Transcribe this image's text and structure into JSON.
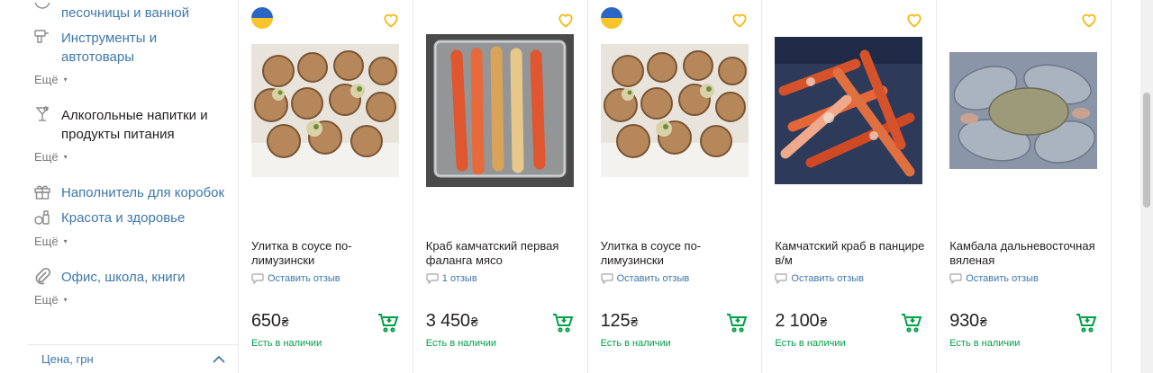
{
  "sidebar": {
    "categories": [
      {
        "label": "песочницы и ванной",
        "icon": "bath-icon"
      },
      {
        "label": "Инструменты и автотовары",
        "icon": "drill-icon"
      },
      {
        "label": "Алкогольные напитки и продукты питания",
        "icon": "glass-icon"
      },
      {
        "label": "Наполнитель для коробок",
        "icon": "gift-icon"
      },
      {
        "label": "Красота и здоровье",
        "icon": "cosmetics-icon"
      },
      {
        "label": "Офис, школа, книги",
        "icon": "paperclip-icon"
      }
    ],
    "more_label": "Ещё",
    "price_filter_label": "Цена, грн"
  },
  "colors": {
    "link": "#3e77aa",
    "available": "#00a046",
    "heart": "#f7b500",
    "ua_blue": "#2b66c5",
    "ua_yellow": "#f7c52a"
  },
  "products": [
    {
      "title": "Улитка в соусе по-лимузински",
      "review": "Оставить отзыв",
      "price": "650",
      "currency": "₴",
      "availability": "Есть в наличии",
      "has_flag": true,
      "photo": "snails-photo"
    },
    {
      "title": "Краб камчатский первая фаланга мясо",
      "review": "1 отзыв",
      "price": "3 450",
      "currency": "₴",
      "availability": "Есть в наличии",
      "has_flag": false,
      "photo": "crab-legs-pack-photo"
    },
    {
      "title": "Улитка в соусе по-лимузински",
      "review": "Оставить отзыв",
      "price": "125",
      "currency": "₴",
      "availability": "Есть в наличии",
      "has_flag": true,
      "photo": "snails-photo"
    },
    {
      "title": "Камчатский краб в панцире в/м",
      "review": "Оставить отзыв",
      "price": "2 100",
      "currency": "₴",
      "availability": "Есть в наличии",
      "has_flag": false,
      "photo": "king-crab-photo"
    },
    {
      "title": "Камбала дальневосточная вяленая",
      "review": "Оставить отзыв",
      "price": "930",
      "currency": "₴",
      "availability": "Есть в наличии",
      "has_flag": false,
      "photo": "dried-flounder-photo"
    }
  ]
}
